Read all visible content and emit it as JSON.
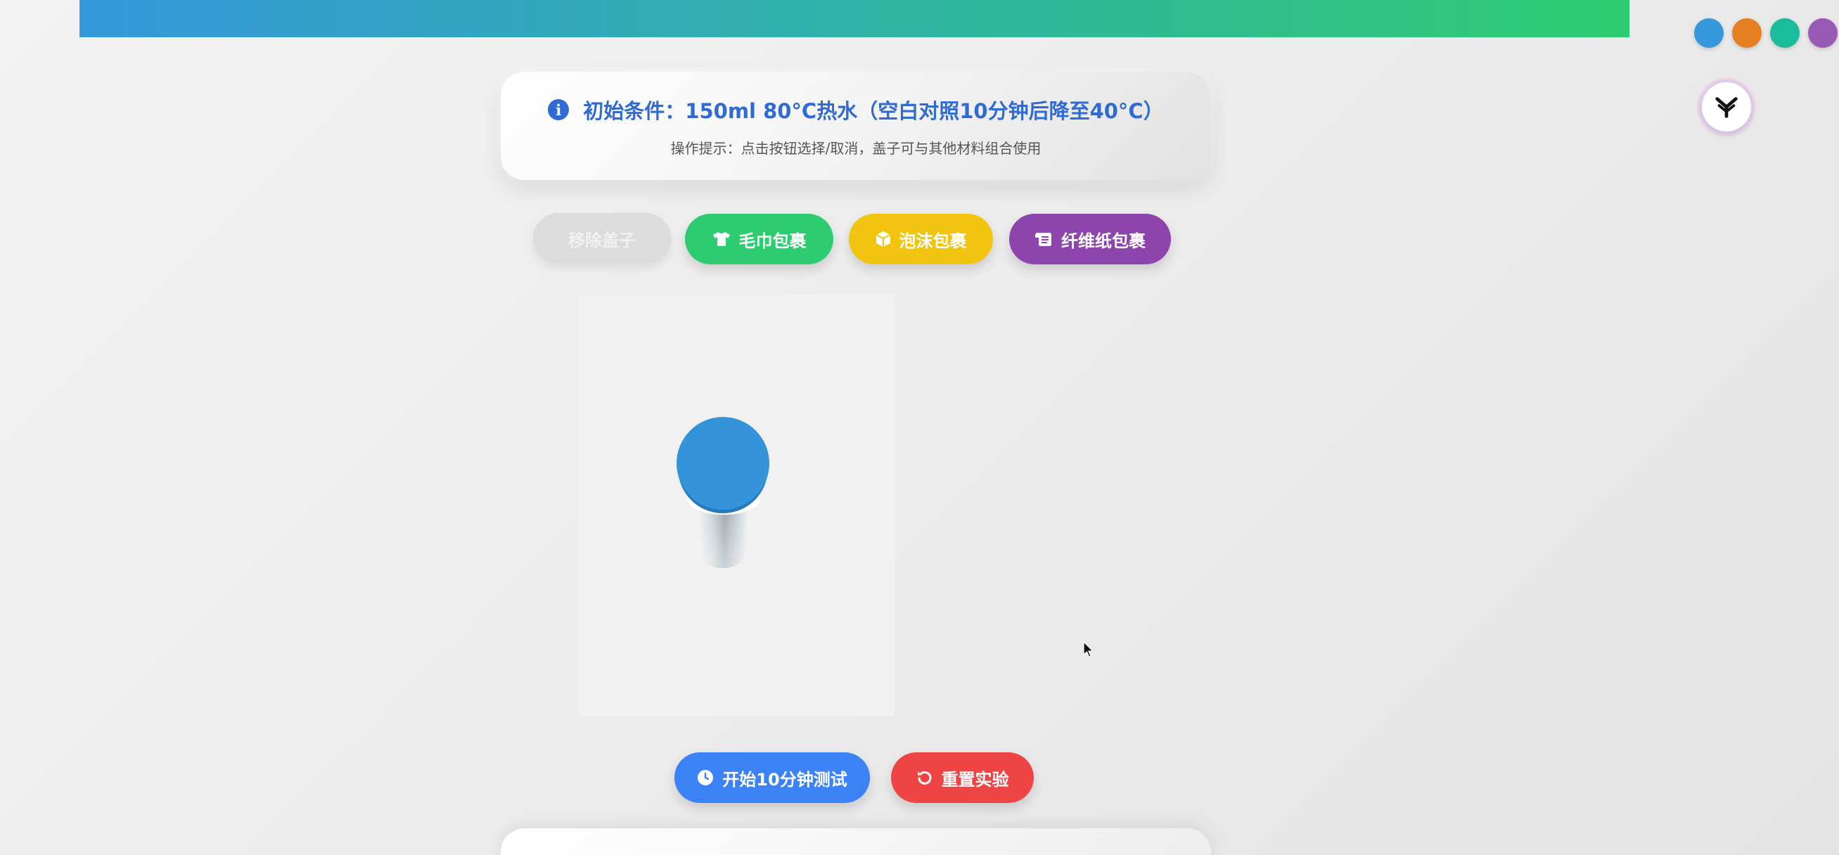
{
  "info": {
    "icon": "info-circle-icon",
    "title": "初始条件：150ml 80°C热水（空白对照10分钟后降至40°C）",
    "hint": "操作提示：点击按钮选择/取消，盖子可与其他材料组合使用"
  },
  "materials": {
    "remove_lid": {
      "label": "移除盖子",
      "state": "disabled"
    },
    "towel": {
      "label": "毛巾包裹",
      "icon": "tshirt-icon",
      "color": "#2ecc71"
    },
    "foam": {
      "label": "泡沫包裹",
      "icon": "cube-icon",
      "color": "#f1c40f"
    },
    "fiber": {
      "label": "纤维纸包裹",
      "icon": "scroll-icon",
      "color": "#8e44ad"
    }
  },
  "scene": {
    "object": "thermos-bottle-3d",
    "lid_color": "#3498db",
    "body_color": "#c9d1d6"
  },
  "actions": {
    "start": {
      "label": "开始10分钟测试",
      "icon": "clock-icon",
      "color": "#3b82f6"
    },
    "reset": {
      "label": "重置实验",
      "icon": "undo-icon",
      "color": "#ef4444"
    }
  },
  "theme": {
    "header_gradient": [
      "#3498db",
      "#2ecc71"
    ],
    "swatches": [
      "#3498db",
      "#e67e22",
      "#1abc9c",
      "#9b59b6"
    ]
  },
  "widget": {
    "icon": "assistant-logo-icon"
  }
}
